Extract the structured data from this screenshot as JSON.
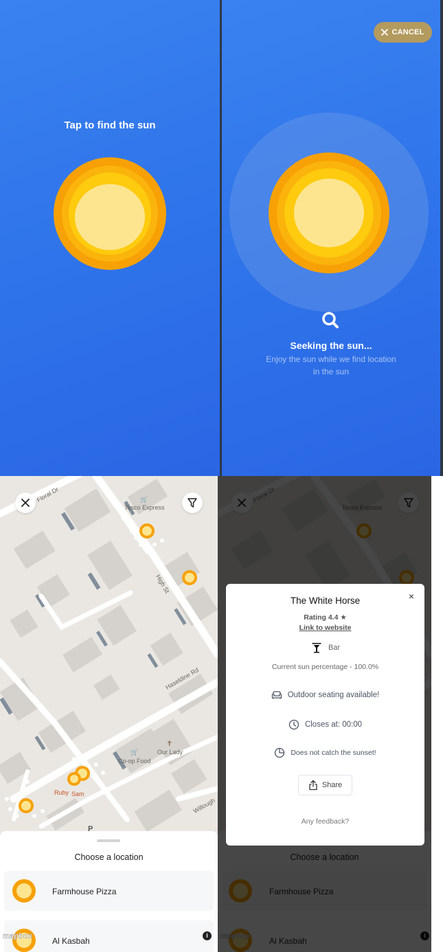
{
  "screen1": {
    "title": "Tap to find the sun",
    "icon": "sun-icon"
  },
  "screen2": {
    "cancel_label": "CANCEL",
    "seeking_title": "Seeking the sun...",
    "seeking_subtitle": "Enjoy the sun while we find location in the sun"
  },
  "map": {
    "labels": {
      "floral_dr": "Floral Dr",
      "tesco": "Tesco Express",
      "high_st": "High St",
      "haseldine": "Haseldine Rd",
      "coop": "Co-op Food",
      "our_lady": "Our Lady",
      "ruby": "Ruby",
      "sam": "Sam",
      "willoughby": "Willough",
      "p": "P"
    },
    "sheet_title": "Choose a location",
    "locations": [
      {
        "name": "Farmhouse Pizza"
      },
      {
        "name": "Al Kasbah"
      }
    ],
    "attribution": "mapbox"
  },
  "venue": {
    "name": "The White Horse",
    "rating": "Rating 4.4 ★",
    "website_link": "Link to website",
    "category": "Bar",
    "sun_percentage": "Current sun percentage - 100.0%",
    "outdoor": "Outdoor seating available!",
    "closes": "Closes at: 00:00",
    "sunset": "Does not catch the sunset!",
    "share_label": "Share",
    "feedback": "Any feedback?"
  },
  "colors": {
    "blue": "#2f74ea",
    "sun_outer": "#f7a106",
    "sun_core": "#fde590",
    "cancel_bg": "#b39a5e"
  }
}
